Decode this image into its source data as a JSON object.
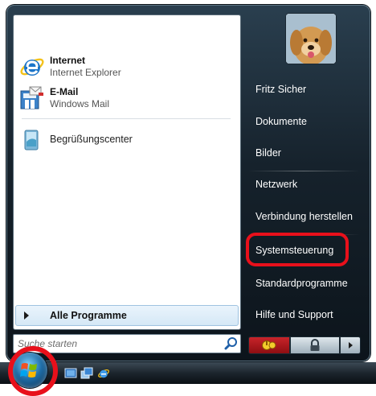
{
  "pinned": [
    {
      "title": "Internet",
      "subtitle": "Internet Explorer",
      "icon": "internet-explorer-icon"
    },
    {
      "title": "E-Mail",
      "subtitle": "Windows Mail",
      "icon": "windows-mail-icon"
    }
  ],
  "recent": [
    {
      "label": "Begrüßungscenter",
      "icon": "welcome-center-icon"
    }
  ],
  "all_programs": {
    "label": "Alle Programme",
    "icon": "arrow-right-icon"
  },
  "search": {
    "placeholder": "Suche starten",
    "icon": "search-icon"
  },
  "right_links": [
    {
      "label": "Fritz Sicher"
    },
    {
      "label": "Dokumente"
    },
    {
      "label": "Bilder"
    },
    {
      "label": "Netzwerk"
    },
    {
      "label": "Verbindung herstellen"
    },
    {
      "label": "Systemsteuerung",
      "highlighted": true
    },
    {
      "label": "Standardprogramme"
    },
    {
      "label": "Hilfe und Support"
    }
  ],
  "user_picture": {
    "icon": "dog-avatar-icon"
  },
  "power": {
    "sleep_icon": "power-icon",
    "lock_icon": "lock-icon",
    "more_icon": "arrow-right-icon"
  },
  "taskbar": {
    "start_icon": "windows-logo-icon",
    "quick_launch": [
      "show-desktop-icon",
      "switch-windows-icon",
      "internet-explorer-icon"
    ]
  },
  "colors": {
    "highlight_ring": "#e8101b",
    "menu_dark": "#16222c",
    "all_programs_bg": "#d5e8f6"
  }
}
